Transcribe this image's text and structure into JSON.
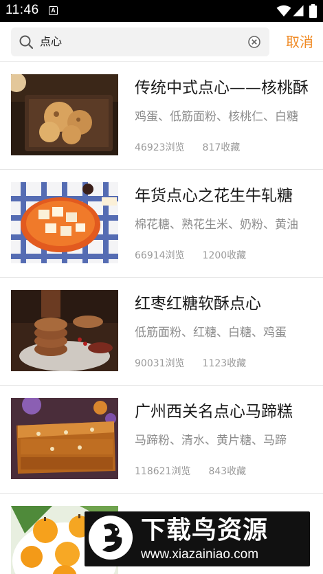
{
  "status_bar": {
    "time": "11:46",
    "notification_icon": "A"
  },
  "search": {
    "query": "点心",
    "cancel_label": "取消"
  },
  "results": [
    {
      "title": "传统中式点心——核桃酥",
      "ingredients": "鸡蛋、低筋面粉、核桃仁、白糖",
      "views": "46923浏览",
      "favorites": "817收藏"
    },
    {
      "title": "年货点心之花生牛轧糖",
      "ingredients": "棉花糖、熟花生米、奶粉、黄油",
      "views": "66914浏览",
      "favorites": "1200收藏"
    },
    {
      "title": "红枣红糖软酥点心",
      "ingredients": "低筋面粉、红糖、白糖、鸡蛋",
      "views": "90031浏览",
      "favorites": "1123收藏"
    },
    {
      "title": "广州西关名点心马蹄糕",
      "ingredients": "马蹄粉、清水、黄片糖、马蹄",
      "views": "118621浏览",
      "favorites": "843收藏"
    },
    {
      "title": "",
      "ingredients": "",
      "views": "",
      "favorites": ""
    }
  ],
  "watermark": {
    "title": "下载鸟资源",
    "url": "www.xiazainiao.com"
  }
}
